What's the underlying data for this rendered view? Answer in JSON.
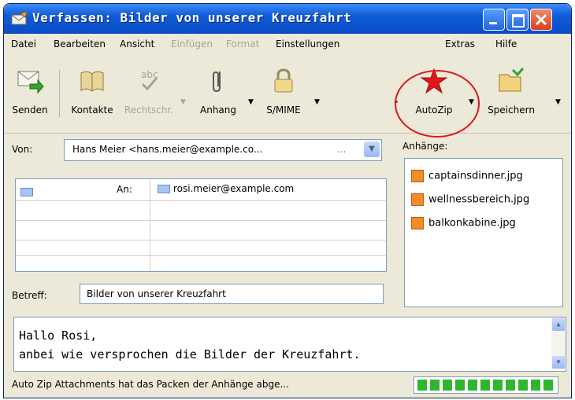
{
  "window": {
    "title": "Verfassen: Bilder von unserer Kreuzfahrt"
  },
  "menu": [
    "Datei",
    "Bearbeiten",
    "Ansicht",
    "Einfügen",
    "Format",
    "Einstellungen",
    "Extras",
    "Hilfe"
  ],
  "menu_disabled": [
    "Einfügen",
    "Format"
  ],
  "toolbar": {
    "senden": "Senden",
    "kontakte": "Kontakte",
    "rechtschr": "Rechtschr.",
    "anhang": "Anhang",
    "smime": "S/MIME",
    "autozip": "AutoZip",
    "speichern": "Speichern"
  },
  "header": {
    "von_label": "Von:",
    "von_value": "Hans Meier <hans.meier@example.co...",
    "von_more": "...",
    "an_label": "An:",
    "an_value": "rosi.meier@example.com",
    "betreff_label": "Betreff:",
    "betreff_value": "Bilder von unserer Kreuzfahrt"
  },
  "attachments": {
    "label": "Anhänge:",
    "items": [
      "captainsdinner.jpg",
      "wellnessbereich.jpg",
      "balkonkabine.jpg"
    ]
  },
  "body": {
    "line1": "Hallo Rosi,",
    "line2": "anbei wie versprochen die Bilder der Kreuzfahrt."
  },
  "status": {
    "text": "Auto Zip Attachments hat das Packen der Anhänge abge...",
    "progress": 1.0
  },
  "colors": {
    "accent": "#0A4CC7",
    "highlight_ring": "#E0161B",
    "progress": "#2FB62F"
  }
}
